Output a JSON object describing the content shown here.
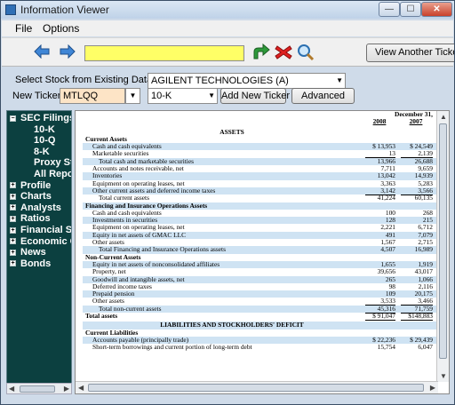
{
  "window": {
    "title": "Information Viewer",
    "min": "—",
    "max": "☐",
    "close": "✕"
  },
  "menu": {
    "file": "File",
    "options": "Options"
  },
  "toolbar": {
    "ticker_value": "",
    "view_another": "View Another Ticker"
  },
  "select_panel": {
    "select_label": "Select Stock from Existing Dataset",
    "company": "AGILENT TECHNOLOGIES (A)",
    "new_ticker_label": "New Ticker",
    "new_ticker_value": "MTLQQ",
    "form_type": "10-K",
    "add_button": "Add New Ticker",
    "advanced_button": "Advanced"
  },
  "tree": [
    {
      "label": "SEC Filings",
      "expander": "−",
      "level": 0
    },
    {
      "label": "10-K",
      "level": 1
    },
    {
      "label": "10-Q",
      "level": 1
    },
    {
      "label": "8-K",
      "level": 1
    },
    {
      "label": "Proxy Statements",
      "level": 1
    },
    {
      "label": "All Reports",
      "level": 1
    },
    {
      "label": "Profile",
      "expander": "+",
      "level": 0
    },
    {
      "label": "Charts",
      "expander": "+",
      "level": 0
    },
    {
      "label": "Analysts",
      "expander": "+",
      "level": 0
    },
    {
      "label": "Ratios",
      "expander": "+",
      "level": 0
    },
    {
      "label": "Financial Statements",
      "expander": "+",
      "level": 0
    },
    {
      "label": "Economic Calendar",
      "expander": "+",
      "level": 0
    },
    {
      "label": "News",
      "expander": "+",
      "level": 0
    },
    {
      "label": "Bonds",
      "expander": "+",
      "level": 0
    }
  ],
  "document": {
    "period_header": "December 31,",
    "col1": "2008",
    "col2": "2007",
    "rows": [
      {
        "label": "ASSETS",
        "type": "center"
      },
      {
        "label": "Current Assets",
        "type": "hdr"
      },
      {
        "label": "Cash and cash equivalents",
        "v1": "$ 13,953",
        "v2": "$ 24,549",
        "shade": true
      },
      {
        "label": "Marketable securities",
        "v1": "13",
        "v2": "2,139",
        "ul": true
      },
      {
        "label": "Total cash and marketable securities",
        "v1": "13,966",
        "v2": "26,688",
        "shade": true,
        "indent": true
      },
      {
        "label": "Accounts and notes receivable, net",
        "v1": "7,711",
        "v2": "9,659"
      },
      {
        "label": "Inventories",
        "v1": "13,042",
        "v2": "14,939",
        "shade": true
      },
      {
        "label": "Equipment on operating leases, net",
        "v1": "3,363",
        "v2": "5,283"
      },
      {
        "label": "Other current assets and deferred income taxes",
        "v1": "3,142",
        "v2": "3,566",
        "shade": true,
        "ul": true
      },
      {
        "label": "Total current assets",
        "v1": "41,224",
        "v2": "60,135",
        "indent": true
      },
      {
        "label": "Financing and Insurance Operations Assets",
        "type": "hdr",
        "shade": true
      },
      {
        "label": "Cash and cash equivalents",
        "v1": "100",
        "v2": "268"
      },
      {
        "label": "Investments in securities",
        "v1": "128",
        "v2": "215",
        "shade": true
      },
      {
        "label": "Equipment on operating leases, net",
        "v1": "2,221",
        "v2": "6,712"
      },
      {
        "label": "Equity in net assets of GMAC LLC",
        "v1": "491",
        "v2": "7,079",
        "shade": true
      },
      {
        "label": "Other assets",
        "v1": "1,567",
        "v2": "2,715",
        "ul": true
      },
      {
        "label": "Total Financing and Insurance Operations assets",
        "v1": "4,507",
        "v2": "16,989",
        "shade": true,
        "indent": true
      },
      {
        "label": "Non-Current Assets",
        "type": "hdr"
      },
      {
        "label": "Equity in net assets of nonconsolidated affiliates",
        "v1": "1,655",
        "v2": "1,919",
        "shade": true
      },
      {
        "label": "Property, net",
        "v1": "39,656",
        "v2": "43,017"
      },
      {
        "label": "Goodwill and intangible assets, net",
        "v1": "265",
        "v2": "1,066",
        "shade": true
      },
      {
        "label": "Deferred income taxes",
        "v1": "98",
        "v2": "2,116"
      },
      {
        "label": "Prepaid pension",
        "v1": "109",
        "v2": "20,175",
        "shade": true
      },
      {
        "label": "Other assets",
        "v1": "3,533",
        "v2": "3,466",
        "ul": true
      },
      {
        "label": "Total non-current assets",
        "v1": "45,316",
        "v2": "71,759",
        "shade": true,
        "indent": true,
        "ul": true
      },
      {
        "label": "Total assets",
        "v1": "$ 91,047",
        "v2": "$148,883",
        "type": "hdr",
        "dul": true
      },
      {
        "label": "LIABILITIES AND STOCKHOLDERS' DEFICIT",
        "type": "center",
        "shade": true
      },
      {
        "label": "Current Liabilities",
        "type": "hdr"
      },
      {
        "label": "Accounts payable (principally trade)",
        "v1": "$ 22,236",
        "v2": "$ 29,439",
        "shade": true
      },
      {
        "label": "Short-term borrowings and current portion of long-term debt",
        "v1": "15,754",
        "v2": "6,047"
      }
    ]
  }
}
